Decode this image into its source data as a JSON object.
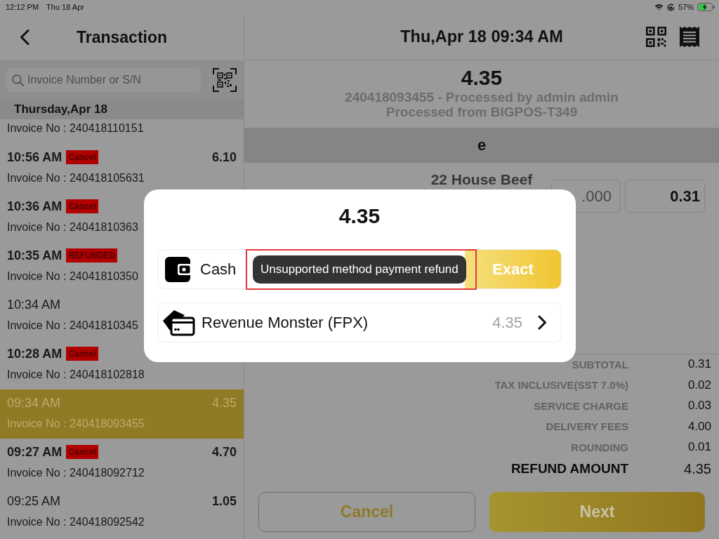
{
  "status_bar": {
    "time": "12:12 PM",
    "date": "Thu 18 Apr",
    "battery": "57%"
  },
  "sidebar": {
    "title": "Transaction",
    "search": {
      "placeholder": "Invoice Number or S/N"
    },
    "date_header": "Thursday,Apr 18",
    "transactions": [
      {
        "invoice": "Invoice No : 240418110151",
        "selected": false
      },
      {
        "time": "10:56 AM",
        "badge": "Cancel",
        "amount": "6.10",
        "invoice": "Invoice No : 240418105631",
        "selected": false
      },
      {
        "time": "10:36 AM",
        "badge": "Cancel",
        "invoice": "Invoice No : 24041810363",
        "selected": false
      },
      {
        "time": "10:35 AM",
        "badge": "REFUNDED",
        "invoice": "Invoice No : 24041810350",
        "selected": false
      },
      {
        "time": "10:34 AM",
        "invoice": "Invoice No : 24041810345",
        "selected": false
      },
      {
        "time": "10:28 AM",
        "badge": "Cancel",
        "invoice": "Invoice No : 240418102818",
        "selected": false
      },
      {
        "time": "09:34 AM",
        "amount": "4.35",
        "invoice": "Invoice No : 240418093455",
        "selected": true
      },
      {
        "time": "09:27 AM",
        "badge": "Cancel",
        "amount": "4.70",
        "invoice": "Invoice No : 240418092712",
        "selected": false
      },
      {
        "time": "09:25 AM",
        "amount": "1.05",
        "invoice": "Invoice No : 240418092542",
        "selected": false
      }
    ]
  },
  "detail": {
    "title": "Thu,Apr 18 09:34 AM",
    "total": "4.35",
    "processed_by": "240418093455 - Processed by admin admin",
    "processed_from": "Processed from BIGPOS-T349",
    "section_title": "e",
    "item": {
      "name": "22 House Beef",
      "quantity": ".000",
      "price": "0.31"
    },
    "summary": [
      {
        "kind": "line",
        "label": "SUBTOTAL",
        "value": "0.31"
      },
      {
        "kind": "line",
        "label": "TAX INCLUSIVE(SST 7.0%)",
        "value": "0.02"
      },
      {
        "kind": "line",
        "label": "SERVICE CHARGE",
        "value": "0.03"
      },
      {
        "kind": "line",
        "label": "DELIVERY FEES",
        "value": "4.00"
      },
      {
        "kind": "line",
        "label": "ROUNDING",
        "value": "0.01"
      },
      {
        "kind": "total",
        "label": "REFUND AMOUNT",
        "value": "4.35"
      }
    ],
    "buttons": [
      {
        "kind": "outline",
        "label": "Cancel"
      },
      {
        "kind": "primary",
        "label": "Next"
      }
    ]
  },
  "refund_dialog": {
    "amount": "4.35",
    "methods": [
      {
        "kind": "cash",
        "label": "Cash",
        "action": "Exact"
      },
      {
        "kind": "gateway",
        "label": "Revenue Monster (FPX)",
        "amount": "4.35"
      }
    ],
    "toast": {
      "text": "Unsupported method payment refund",
      "highlighted": true
    }
  }
}
